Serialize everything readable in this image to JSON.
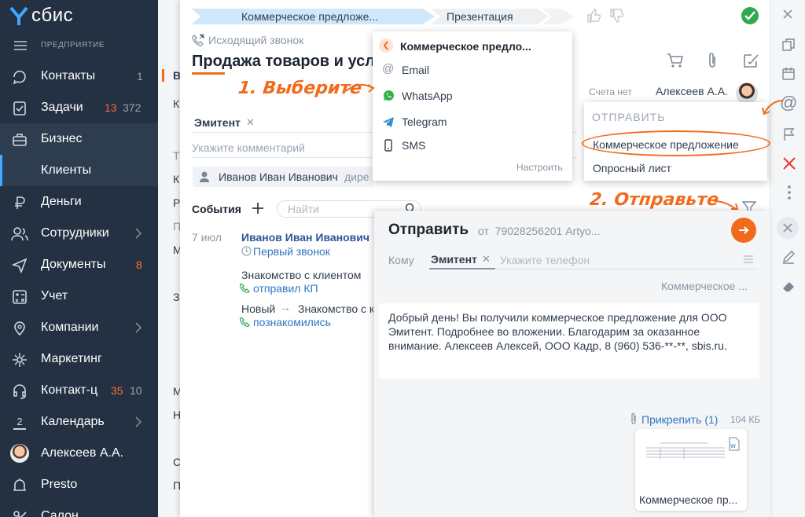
{
  "sidebar": {
    "logo": "сбис",
    "org": "ПРЕДПРИЯТИЕ",
    "items": [
      {
        "label": "Контакты",
        "count": "1",
        "icon": "contacts-icon"
      },
      {
        "label": "Задачи",
        "count_red": "13",
        "count": "372",
        "icon": "tasks-icon"
      },
      {
        "label": "Бизнес",
        "icon": "briefcase-icon"
      },
      {
        "label": "Клиенты"
      },
      {
        "label": "Деньги",
        "icon": "ruble-icon"
      },
      {
        "label": "Сотрудники",
        "icon": "employees-icon"
      },
      {
        "label": "Документы",
        "count_red": "8",
        "icon": "documents-icon"
      },
      {
        "label": "Учет",
        "icon": "accounting-icon"
      },
      {
        "label": "Компании",
        "icon": "companies-icon"
      },
      {
        "label": "Маркетинг",
        "icon": "marketing-icon"
      },
      {
        "label": "Контакт-ц",
        "count_red": "35",
        "count": "10",
        "icon": "contact-center-icon"
      },
      {
        "label": "Календарь",
        "icon": "calendar-icon",
        "badge": "2"
      },
      {
        "label": "Алексеев А.А.",
        "icon": "avatar"
      },
      {
        "label": "Presto",
        "icon": "presto-icon"
      },
      {
        "label": "Салон",
        "icon": "salon-icon"
      }
    ]
  },
  "behind": {
    "letters": [
      "В",
      "К",
      "Т",
      "К",
      "Р",
      "П",
      "М",
      "З",
      "М",
      "Н",
      "С",
      "П"
    ]
  },
  "card": {
    "stage1": "Коммерческое предложе...",
    "stage2": "Презентация",
    "call_type": "Исходящий звонок",
    "title": "Продажа товаров и усл",
    "invoices": "Счета нет",
    "manager": "Алексеев А.А.",
    "issuer_tag": "Эмитент",
    "comment_placeholder": "Укажите комментарий",
    "contact_name": "Иванов Иван Иванович",
    "contact_role": "дире",
    "events_label": "События",
    "search_placeholder": "Найти",
    "event_date": "7 июл",
    "event_person": "Иванов Иван Иванович",
    "event_call": "Первый звонок",
    "event_step1": "Знакомство с клиентом",
    "event_step1_sub": "отправил КП",
    "event_step2_from": "Новый",
    "event_step2_to": "Знакомство с к",
    "event_step2_sub": "познакомились"
  },
  "dropdown": {
    "header": "Коммерческое предло...",
    "items": [
      "Email",
      "WhatsApp",
      "Telegram",
      "SMS"
    ],
    "configure": "Настроить"
  },
  "sendmenu": {
    "title": "ОТПРАВИТЬ",
    "items": [
      "Коммерческое предложение",
      "Опросный лист"
    ]
  },
  "callouts": {
    "step1": "1. Выберите",
    "step2": "2. Отправьте"
  },
  "panel": {
    "title": "Отправить",
    "from": "от  79028256201 Artyo...",
    "to_label": "Кому",
    "recipient": "Эмитент",
    "phone_placeholder": "Укажите телефон",
    "template": "Коммерческое ...",
    "message": "Добрый день! Вы получили коммерческое предложение для ООО Эмитент. Подробнее во вложении. Благодарим за оказанное внимание.  Алексеев Алексей, ООО Кадр, 8 (960) 536-**-**, sbis.ru.",
    "attach": "Прикрепить (1)",
    "attach_size": "104 КБ",
    "file_name": "Коммерческое пр..."
  },
  "colors": {
    "sidebar_bg": "#233142",
    "accent_orange": "#f26b1d",
    "link_blue": "#2f77c1",
    "success_green": "#2fa84f",
    "badge_red": "#ff7033"
  }
}
